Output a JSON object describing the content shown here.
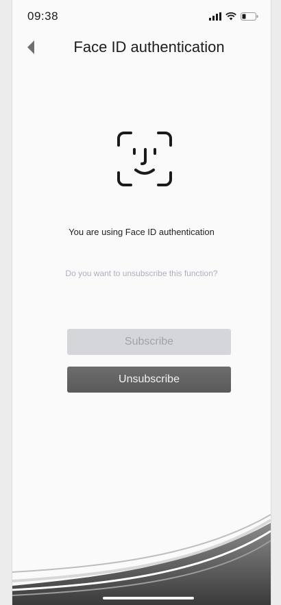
{
  "status_bar": {
    "time": "09:38",
    "icons": [
      "signal-icon",
      "wifi-icon",
      "battery-icon"
    ]
  },
  "nav": {
    "back_icon": "back-arrow-icon",
    "title": "Face ID authentication"
  },
  "main": {
    "icon": "face-id-icon",
    "info": "You are using Face ID authentication",
    "question": "Do you want to unsubscribe this function?",
    "subscribe_label": "Subscribe",
    "unsubscribe_label": "Unsubscribe"
  },
  "colors": {
    "background": "#fafafa",
    "subscribe_bg": "#d4d6d9",
    "unsubscribe_bg": "#5f5f5f",
    "question_text": "#a9b0bd"
  }
}
